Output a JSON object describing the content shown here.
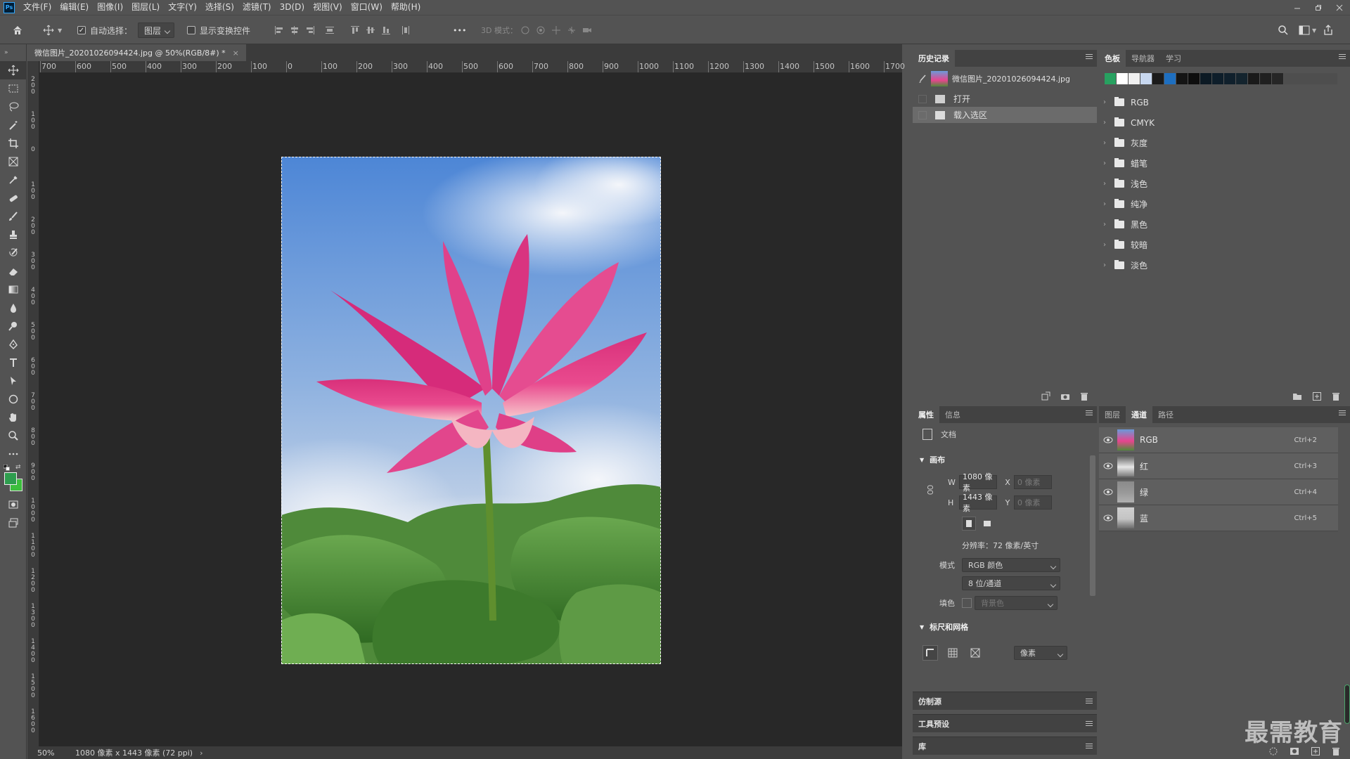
{
  "app": {
    "logo": "Ps"
  },
  "menu": [
    "文件(F)",
    "编辑(E)",
    "图像(I)",
    "图层(L)",
    "文字(Y)",
    "选择(S)",
    "滤镜(T)",
    "3D(D)",
    "视图(V)",
    "窗口(W)",
    "帮助(H)"
  ],
  "options": {
    "auto_select_label": "自动选择：",
    "auto_select_value": "图层",
    "show_transform_label": "显示变换控件",
    "more": "•••",
    "mode3d_label": "3D 模式："
  },
  "document": {
    "tab_title": "微信图片_20201026094424.jpg @ 50%(RGB/8#) *",
    "ruler_h": [
      "700",
      "600",
      "500",
      "400",
      "300",
      "200",
      "100",
      "0",
      "100",
      "200",
      "300",
      "400",
      "500",
      "600",
      "700",
      "800",
      "900",
      "1000",
      "1100",
      "1200",
      "1300",
      "1400",
      "1500",
      "1600",
      "1700"
    ],
    "ruler_v": [
      "2\n0\n0",
      "1\n0\n0",
      "0",
      "1\n0\n0",
      "2\n0\n0",
      "3\n0\n0",
      "4\n0\n0",
      "5\n0\n0",
      "6\n0\n0",
      "7\n0\n0",
      "8\n0\n0",
      "9\n0\n0",
      "1\n0\n0\n0",
      "1\n1\n0\n0",
      "1\n2\n0\n0",
      "1\n3\n0\n0",
      "1\n4\n0\n0",
      "1\n5\n0\n0",
      "1\n6\n0\n0"
    ]
  },
  "status": {
    "zoom": "50%",
    "info": "1080 像素 x 1443 像素 (72 ppi)"
  },
  "history": {
    "tab": "历史记录",
    "snapshot": "微信图片_20201026094424.jpg",
    "items": [
      "打开",
      "载入选区"
    ]
  },
  "swatches_panel": {
    "tabs": [
      "色板",
      "导航器",
      "学习"
    ],
    "colors": [
      "#27a160",
      "#ffffff",
      "#f0f0f0",
      "#c8d8f0",
      "#1b1b1b",
      "#1e6fc0",
      "#151515",
      "#0e0e0e",
      "#0c1a24",
      "#0e1e2a",
      "#10202c",
      "#14242e",
      "#1a1a1a",
      "#202020",
      "#262626"
    ],
    "folders": [
      "RGB",
      "CMYK",
      "灰度",
      "蜡笔",
      "浅色",
      "纯净",
      "黑色",
      "较暗",
      "淡色"
    ]
  },
  "properties": {
    "tabs": [
      "属性",
      "信息"
    ],
    "doc_label": "文档",
    "canvas_section": "画布",
    "w_label": "W",
    "w_value": "1080 像素",
    "h_label": "H",
    "h_value": "1443 像素",
    "x_label": "X",
    "x_value": "0 像素",
    "y_label": "Y",
    "y_value": "0 像素",
    "resolution": "分辨率：72 像素/英寸",
    "mode_label": "模式",
    "mode_value": "RGB 颜色",
    "depth_value": "8 位/通道",
    "fill_label": "填色",
    "fill_value": "背景色",
    "rulers_section": "标尺和网格",
    "units_value": "像素"
  },
  "channels_panel": {
    "tabs": [
      "图层",
      "通道",
      "路径"
    ],
    "channels": [
      {
        "name": "RGB",
        "shortcut": "Ctrl+2"
      },
      {
        "name": "红",
        "shortcut": "Ctrl+3"
      },
      {
        "name": "绿",
        "shortcut": "Ctrl+4"
      },
      {
        "name": "蓝",
        "shortcut": "Ctrl+5"
      }
    ]
  },
  "collapsed_panels": [
    "仿制源",
    "工具预设",
    "库"
  ],
  "watermark": "最需教育",
  "colors": {
    "foreground": "#2e9d4e",
    "background": "#3cbf3c",
    "selection_row": "#6b6b6b"
  }
}
